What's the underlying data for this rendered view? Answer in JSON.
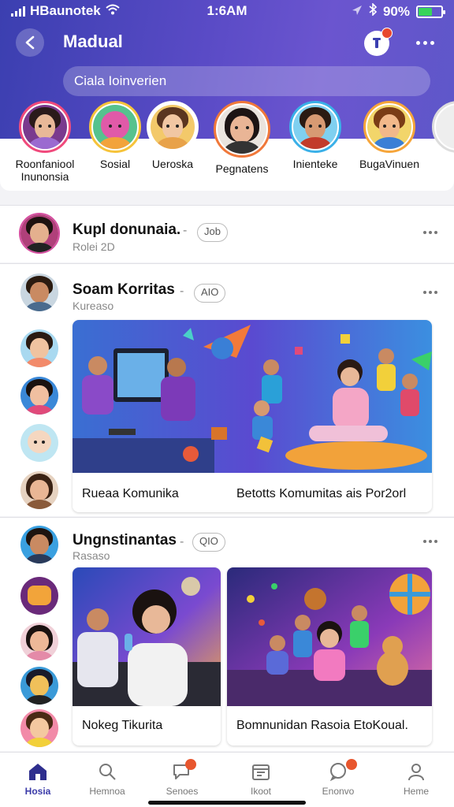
{
  "status_bar": {
    "carrier": "HBaunotek",
    "time": "1:6AM",
    "battery": "90%"
  },
  "header": {
    "title": "Madual",
    "search_placeholder": "Ciala Ioinverien"
  },
  "stories": [
    {
      "label_line1": "Roonfaniool",
      "label_line2": "Inunonsia"
    },
    {
      "label_line1": "Sosial",
      "label_line2": ""
    },
    {
      "label_line1": "Ueroska",
      "label_line2": ""
    },
    {
      "label_line1": "Pegnatens",
      "label_line2": ""
    },
    {
      "label_line1": "Inienteke",
      "label_line2": ""
    },
    {
      "label_line1": "BugaVinuen",
      "label_line2": ""
    }
  ],
  "posts": [
    {
      "name": "Kupl donunaia.",
      "subtitle": "Rolei 2D",
      "chip": "Job",
      "cards": []
    },
    {
      "name": "Soam Korritas",
      "subtitle": "Kureaso",
      "chip": "AIO",
      "cards": [
        {
          "caption_left": "Rueaa Komunika",
          "caption_right": "Betotts Komumitas ais Por2orl"
        }
      ]
    },
    {
      "name": "Ungnstinantas",
      "subtitle": "Rasaso",
      "chip": "QIO",
      "cards": [
        {
          "caption": "Nokeg Tikurita"
        },
        {
          "caption": "Bomnunidan Rasoia EtoKoual."
        }
      ]
    }
  ],
  "bottom_nav": [
    {
      "label": "Hosia",
      "icon": "home-icon",
      "active": true
    },
    {
      "label": "Hemnoa",
      "icon": "search-icon",
      "active": false
    },
    {
      "label": "Senoes",
      "icon": "chat-icon",
      "active": false
    },
    {
      "label": "Ikoot",
      "icon": "calendar-icon",
      "active": false
    },
    {
      "label": "Enonvo",
      "icon": "message-icon",
      "active": false
    },
    {
      "label": "Heme",
      "icon": "profile-icon",
      "active": false
    }
  ],
  "colors": {
    "header_gradient_start": "#3b3fb0",
    "header_gradient_end": "#6b55cf",
    "story_ring": "#f04a7c",
    "badge": "#e8472e",
    "nav_active": "#3a3aa8"
  }
}
